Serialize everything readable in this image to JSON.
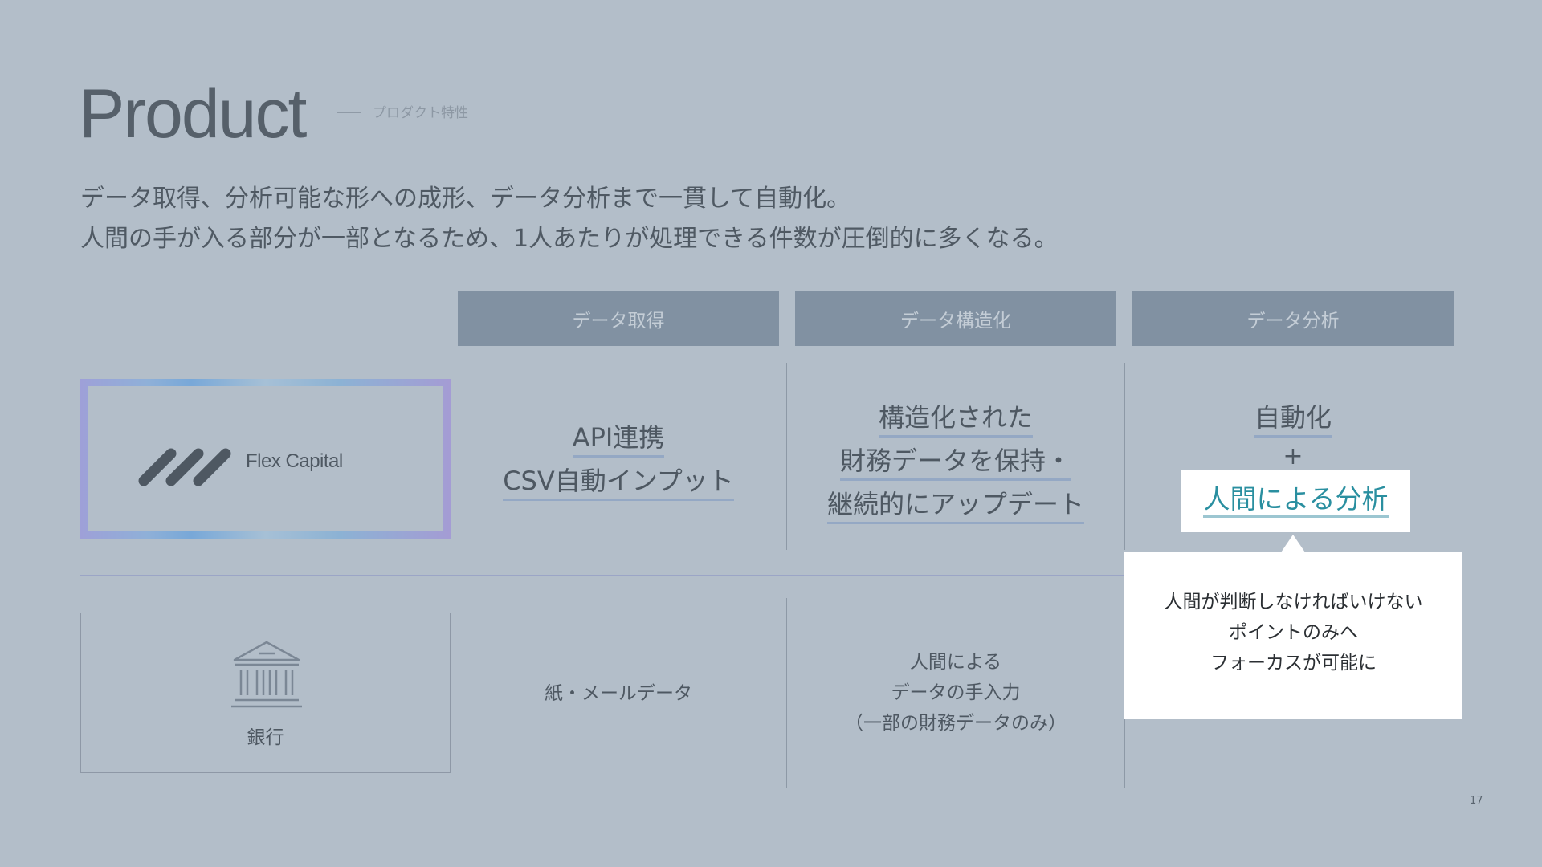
{
  "header": {
    "title": "Product",
    "subtitle": "プロダクト特性"
  },
  "lead": {
    "line1": "データ取得、分析可能な形への成形、データ分析まで一貫して自動化。",
    "line2": "人間の手が入る部分が一部となるため、1人あたりが処理できる件数が圧倒的に多くなる。"
  },
  "columns": [
    {
      "label": "データ取得"
    },
    {
      "label": "データ構造化"
    },
    {
      "label": "データ分析"
    }
  ],
  "flex_capital": {
    "name": "Flex Capital",
    "acquisition": [
      "API連携",
      "CSV自動インプット"
    ],
    "structuring": [
      "構造化された",
      "財務データを保持・",
      "継続的にアップデート"
    ],
    "analysis_top": "自動化",
    "analysis_plus": "+",
    "analysis_highlight": "人間による分析",
    "callout": [
      "人間が判断しなければいけない",
      "ポイントのみへ",
      "フォーカスが可能に"
    ]
  },
  "bank": {
    "name": "銀行",
    "icon": "bank-building-icon",
    "acquisition": "紙・メールデータ",
    "structuring": [
      "人間による",
      "データの手入力",
      "（一部の財務データのみ）"
    ]
  },
  "page": {
    "number": "17"
  },
  "colors": {
    "background": "#b3bec9",
    "header_fill": "#8191a2",
    "highlight_text": "#2a8fa0"
  }
}
